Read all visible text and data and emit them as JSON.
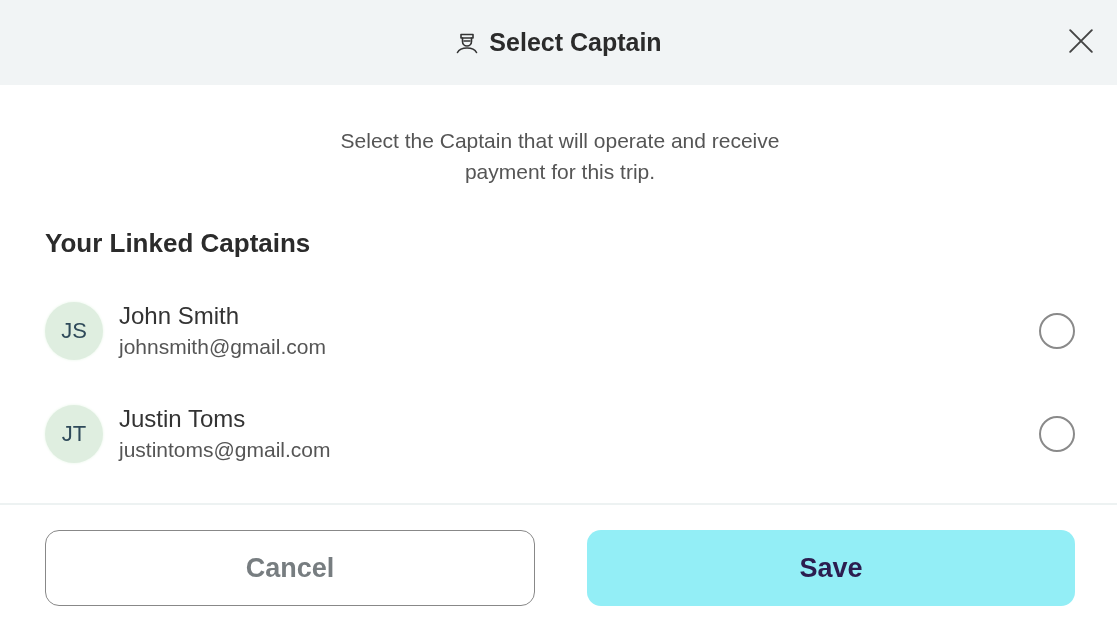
{
  "dialog": {
    "title": "Select Captain",
    "description": "Select the Captain that will operate and receive payment for this trip."
  },
  "section": {
    "heading": "Your Linked Captains"
  },
  "captains": [
    {
      "initials": "JS",
      "name": "John Smith",
      "email": "johnsmith@gmail.com",
      "selected": false
    },
    {
      "initials": "JT",
      "name": "Justin Toms",
      "email": "justintoms@gmail.com",
      "selected": false
    }
  ],
  "buttons": [
    {
      "kind": "secondary",
      "label": "Cancel"
    },
    {
      "kind": "primary",
      "label": "Save"
    }
  ]
}
